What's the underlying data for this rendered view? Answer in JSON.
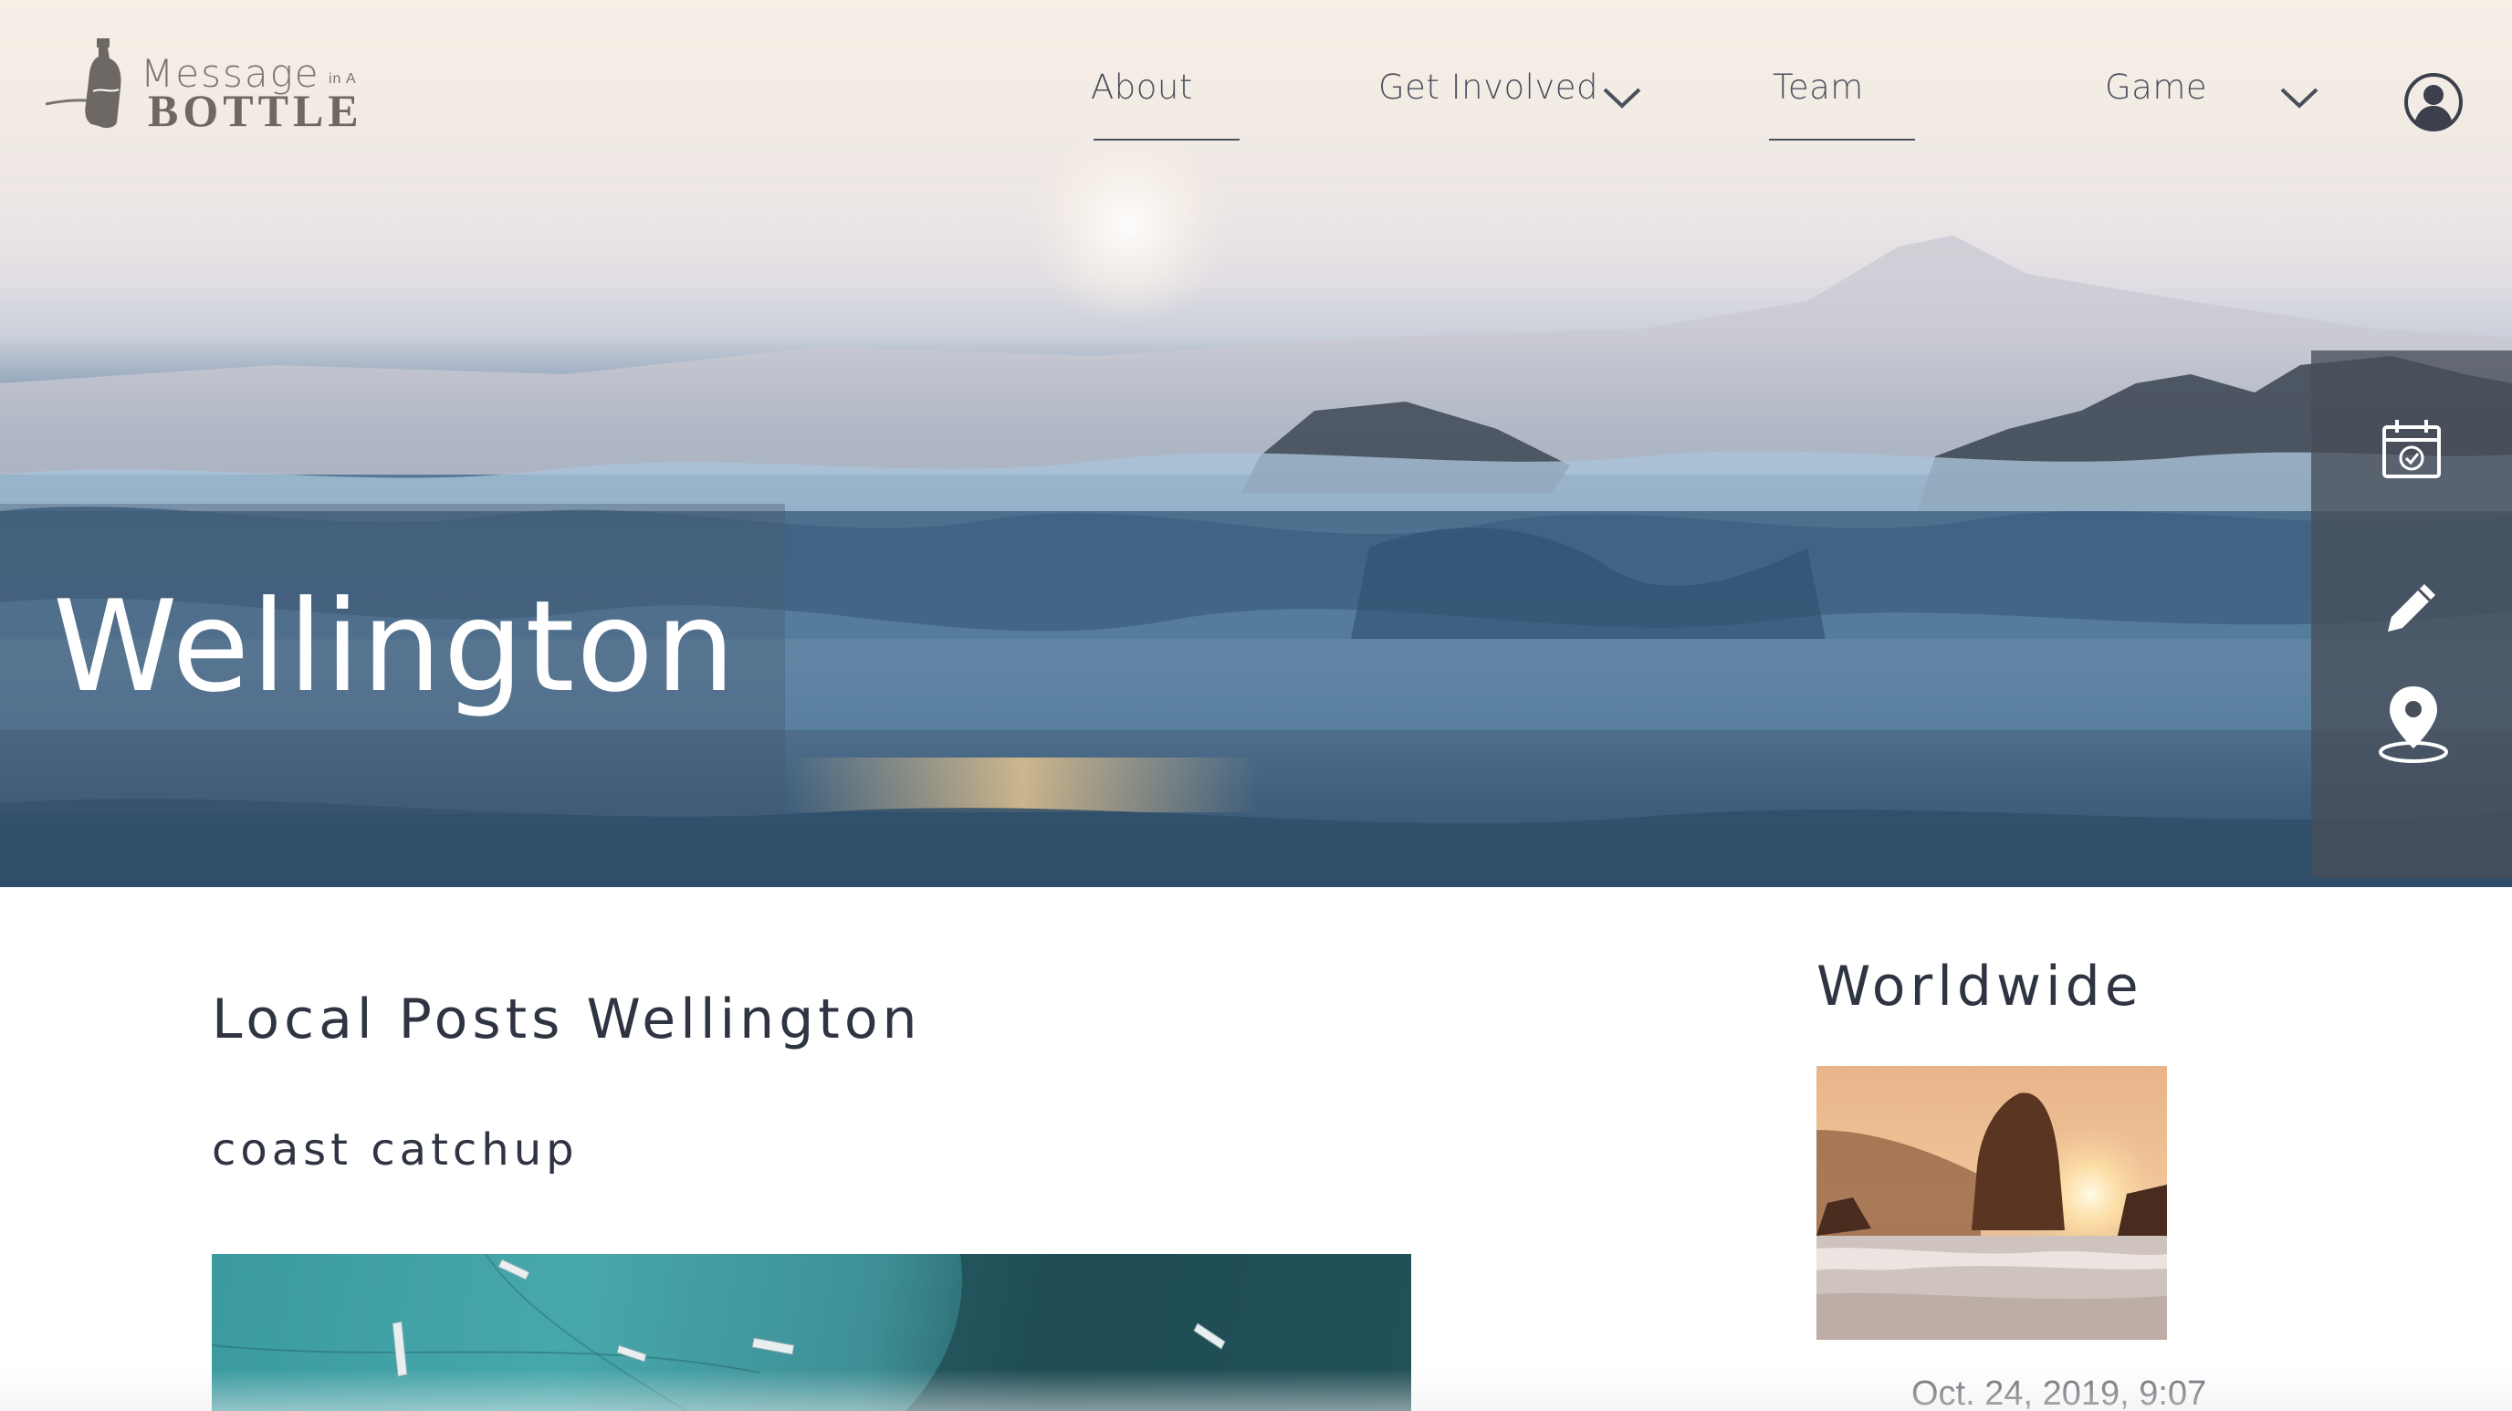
{
  "brand": {
    "logo_top": "Message",
    "logo_small": "in A",
    "logo_bottom": "BOTTLE"
  },
  "nav": {
    "items": [
      {
        "label": "About",
        "has_dropdown": false
      },
      {
        "label": "Get Involved",
        "has_dropdown": true
      },
      {
        "label": "Team",
        "has_dropdown": false
      },
      {
        "label": "Game",
        "has_dropdown": true
      }
    ],
    "account_icon": "user-circle-icon"
  },
  "hero": {
    "title": "Wellington"
  },
  "side_tools": [
    {
      "icon": "calendar-check-icon"
    },
    {
      "icon": "pencil-icon"
    },
    {
      "icon": "map-pin-icon"
    }
  ],
  "local": {
    "heading": "Local Posts Wellington",
    "post_title": "coast catchup"
  },
  "worldwide": {
    "heading": "Worldwide",
    "date": "Oct. 24, 2019, 9:07"
  },
  "colors": {
    "text_dark": "#2f3442",
    "nav_text": "#4a4f5c",
    "logo_gray": "#7a7470",
    "sidebar_bg": "#484e5a"
  }
}
